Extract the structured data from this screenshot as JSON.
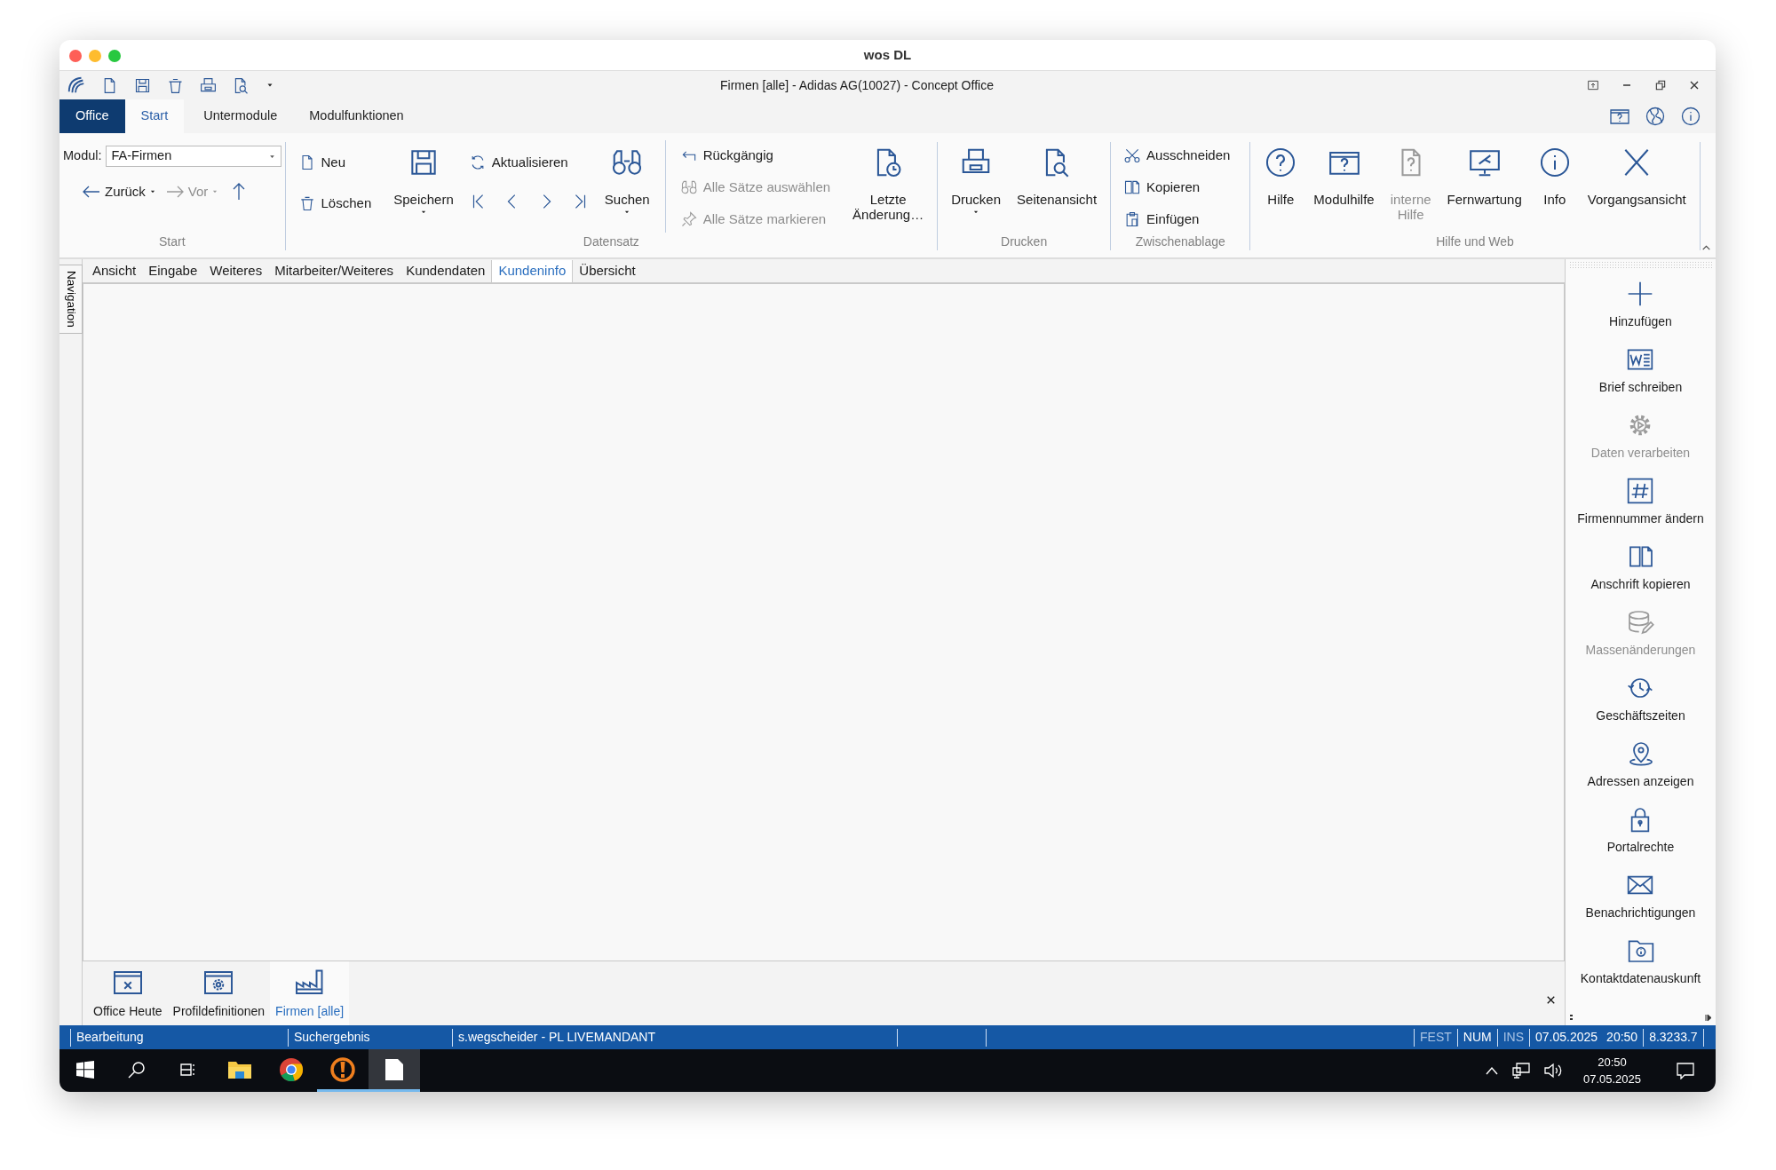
{
  "mac_window": {
    "title": "wos DL"
  },
  "app_title": "Firmen [alle] - Adidas AG(10027) - Concept Office",
  "ribbon_tabs": [
    {
      "label": "Office",
      "kind": "file",
      "selected": false
    },
    {
      "label": "Start",
      "kind": "tab",
      "selected": true
    },
    {
      "label": "Untermodule",
      "kind": "tab",
      "selected": false
    },
    {
      "label": "Modulfunktionen",
      "kind": "tab",
      "selected": false
    }
  ],
  "ribbon": {
    "start_group": {
      "label": "Start",
      "modul_label": "Modul:",
      "modul_value": "FA-Firmen",
      "nav": [
        {
          "label": "Zurück",
          "disabled": false
        },
        {
          "label": "Vor",
          "disabled": true
        }
      ]
    },
    "groups": [
      {
        "label": "Datensatz",
        "columns": [
          {
            "kind": "stack",
            "items": [
              {
                "kind": "button",
                "label": "Neu",
                "disabled": false
              },
              {
                "kind": "button",
                "label": "Löschen",
                "disabled": false
              }
            ]
          },
          {
            "kind": "large",
            "label": "Speichern",
            "disabled": false,
            "dropdown": true
          },
          {
            "kind": "stack",
            "items": [
              {
                "kind": "button",
                "label": "Aktualisieren",
                "disabled": false
              },
              {
                "kind": "record-nav"
              }
            ]
          },
          {
            "kind": "large",
            "label": "Suchen",
            "disabled": false,
            "dropdown": true
          },
          {
            "kind": "separator"
          },
          {
            "kind": "stack",
            "items": [
              {
                "kind": "button",
                "label": "Rückgängig",
                "disabled": false
              },
              {
                "kind": "button",
                "label": "Alle Sätze auswählen",
                "disabled": true
              },
              {
                "kind": "button",
                "label": "Alle Sätze markieren",
                "disabled": true
              }
            ]
          },
          {
            "kind": "large",
            "label": "Letzte\nÄnderung…",
            "disabled": false,
            "dropdown": false
          }
        ]
      },
      {
        "label": "Drucken",
        "columns": [
          {
            "kind": "large",
            "label": "Drucken",
            "disabled": false,
            "dropdown": true
          },
          {
            "kind": "large",
            "label": "Seitenansicht",
            "disabled": false,
            "dropdown": false
          }
        ]
      },
      {
        "label": "Zwischenablage",
        "columns": [
          {
            "kind": "stack",
            "items": [
              {
                "kind": "button",
                "label": "Ausschneiden",
                "disabled": false
              },
              {
                "kind": "button",
                "label": "Kopieren",
                "disabled": false
              },
              {
                "kind": "button",
                "label": "Einfügen",
                "disabled": false
              }
            ]
          }
        ]
      },
      {
        "label": "Hilfe und Web",
        "columns": [
          {
            "kind": "large",
            "label": "Hilfe",
            "disabled": false,
            "dropdown": false
          },
          {
            "kind": "large",
            "label": "Modulhilfe",
            "disabled": false,
            "dropdown": false
          },
          {
            "kind": "large",
            "label": "interne\nHilfe",
            "disabled": true,
            "dropdown": false
          },
          {
            "kind": "large",
            "label": "Fernwartung",
            "disabled": false,
            "dropdown": false
          },
          {
            "kind": "large",
            "label": "Info",
            "disabled": false,
            "dropdown": false
          },
          {
            "kind": "large",
            "label": "Vorgangsansicht",
            "disabled": false,
            "dropdown": false
          }
        ]
      }
    ]
  },
  "navigation_tab": "Navigation",
  "content_tabs": [
    {
      "label": "Ansicht",
      "selected": false
    },
    {
      "label": "Eingabe",
      "selected": false
    },
    {
      "label": "Weiteres",
      "selected": false
    },
    {
      "label": "Mitarbeiter/Weiteres",
      "selected": false
    },
    {
      "label": "Kundendaten",
      "selected": false
    },
    {
      "label": "Kundeninfo",
      "selected": true
    },
    {
      "label": "Übersicht",
      "selected": false
    }
  ],
  "modules": [
    {
      "label": "Office Heute",
      "selected": false
    },
    {
      "label": "Profildefinitionen",
      "selected": false
    },
    {
      "label": "Firmen [alle]",
      "selected": true
    }
  ],
  "actions": [
    {
      "label": "Hinzufügen",
      "disabled": false
    },
    {
      "label": "Brief schreiben",
      "disabled": false
    },
    {
      "label": "Daten verarbeiten",
      "disabled": true
    },
    {
      "label": "Firmennummer ändern",
      "disabled": false
    },
    {
      "label": "Anschrift kopieren",
      "disabled": false
    },
    {
      "label": "Massenänderungen",
      "disabled": true
    },
    {
      "label": "Geschäftszeiten",
      "disabled": false
    },
    {
      "label": "Adressen anzeigen",
      "disabled": false
    },
    {
      "label": "Portalrechte",
      "disabled": false
    },
    {
      "label": "Benachrichtigungen",
      "disabled": false
    },
    {
      "label": "Kontaktdatenauskunft",
      "disabled": false
    }
  ],
  "status_bar": {
    "fields": [
      "Bearbeitung",
      "Suchergebnis",
      "s.wegscheider - PL LIVEMANDANT"
    ],
    "indicators": [
      {
        "label": "FEST",
        "on": false
      },
      {
        "label": "NUM",
        "on": true
      },
      {
        "label": "INS",
        "on": false
      }
    ],
    "date": "07.05.2025",
    "time": "20:50",
    "version": "8.3233.7"
  },
  "taskbar": {
    "apps": [
      {
        "running": false,
        "selected": false
      },
      {
        "running": false,
        "selected": false
      },
      {
        "running": true,
        "selected": false
      },
      {
        "running": true,
        "selected": true
      }
    ],
    "clock_time": "20:50",
    "clock_date": "07.05.2025"
  }
}
